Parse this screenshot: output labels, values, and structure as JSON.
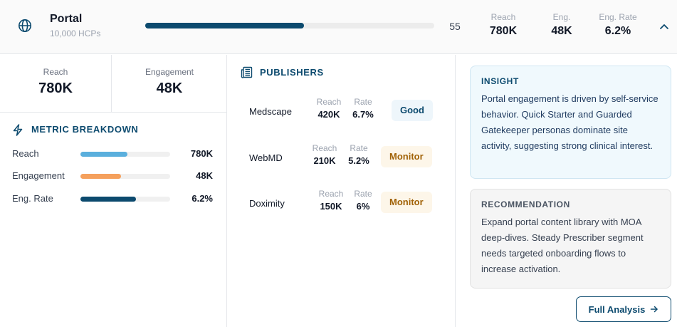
{
  "header": {
    "channel_name": "Portal",
    "channel_sub": "10,000 HCPs",
    "score": 55,
    "score_label": "55",
    "stats": [
      {
        "label": "Reach",
        "value": "780K"
      },
      {
        "label": "Eng.",
        "value": "48K"
      },
      {
        "label": "Eng. Rate",
        "value": "6.2%"
      }
    ],
    "icons": {
      "channel": "globe-icon",
      "toggle": "chevron-up-icon"
    }
  },
  "kpis": {
    "reach": {
      "label": "Reach",
      "value": "780K"
    },
    "engagement": {
      "label": "Engagement",
      "value": "48K"
    }
  },
  "metric_breakdown": {
    "title": "METRIC BREAKDOWN",
    "icon": "bolt-icon",
    "rows": [
      {
        "label": "Reach",
        "value": "780K",
        "level": 0.52,
        "color": "#5aafdd"
      },
      {
        "label": "Engagement",
        "value": "48K",
        "level": 0.45,
        "color": "#f5a05c"
      },
      {
        "label": "Eng. Rate",
        "value": "6.2%",
        "level": 0.62,
        "color": "#0c4a6e"
      }
    ]
  },
  "publishers": {
    "title": "PUBLISHERS",
    "icon": "newspaper-icon",
    "rows": [
      {
        "name": "Medscape",
        "reach_label": "Reach",
        "reach": "420K",
        "rate_label": "Rate",
        "rate": "6.7%",
        "status": "Good",
        "status_kind": "good"
      },
      {
        "name": "WebMD",
        "reach_label": "Reach",
        "reach": "210K",
        "rate_label": "Rate",
        "rate": "5.2%",
        "status": "Monitor",
        "status_kind": "monitor"
      },
      {
        "name": "Doximity",
        "reach_label": "Reach",
        "reach": "150K",
        "rate_label": "Rate",
        "rate": "6%",
        "status": "Monitor",
        "status_kind": "monitor"
      }
    ]
  },
  "insight": {
    "title": "INSIGHT",
    "body": "Portal engagement is driven by self-service behavior. Quick Starter and Guarded Gatekeeper personas dominate site activity, suggesting strong clinical interest."
  },
  "recommendation": {
    "title": "RECOMMENDATION",
    "body": "Expand portal content library with MOA deep-dives. Steady Prescriber segment needs targeted onboarding flows to increase activation."
  },
  "actions": {
    "full_analysis": "Full Analysis",
    "arrow_icon": "arrow-right-icon"
  },
  "colors": {
    "accent": "#0c4a6e",
    "good_bg": "#eef6fb",
    "monitor_bg": "#fdf6e9",
    "monitor_text": "#a16207"
  }
}
